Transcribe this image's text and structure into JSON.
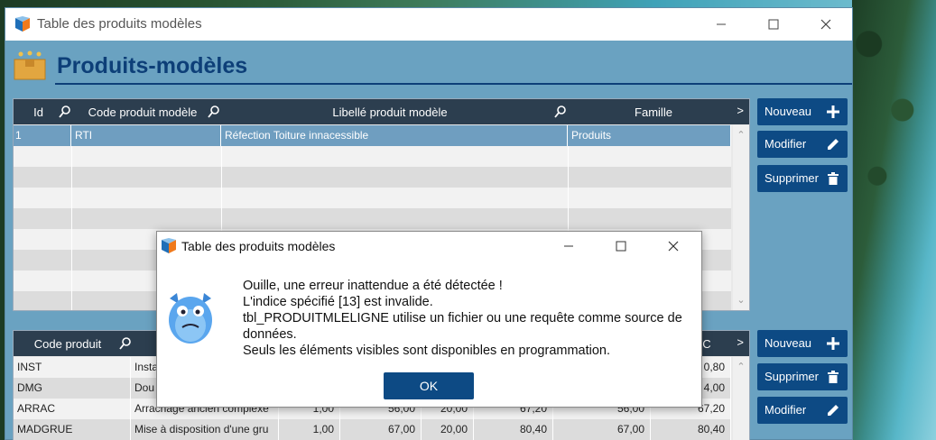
{
  "window": {
    "title": "Table des produits modèles",
    "page_title": "Produits-modèles"
  },
  "top_grid": {
    "columns": [
      "Id",
      "Code produit modèle",
      "Libellé produit modèle",
      "Famille"
    ],
    "more_icon": ">",
    "rows": [
      {
        "id": "1",
        "code": "RTI",
        "libelle": "Réfection Toiture innacessible",
        "famille": "Produits"
      }
    ]
  },
  "top_buttons": {
    "new": "Nouveau",
    "edit": "Modifier",
    "delete": "Supprimer"
  },
  "bottom_grid": {
    "columns": [
      "Code produit"
    ],
    "right_header_fragment": "C",
    "more_icon": ">",
    "rows": [
      {
        "code": "INST",
        "libelle": "Insta",
        "c1": "",
        "c2": "",
        "c3": "",
        "c4": "",
        "c5": "",
        "c6": "0,80"
      },
      {
        "code": "DMG",
        "libelle": "Dou",
        "c1": "",
        "c2": "",
        "c3": "",
        "c4": "",
        "c5": "",
        "c6": "4,00"
      },
      {
        "code": "ARRAC",
        "libelle": "Arrachage ancien complexe",
        "c1": "1,00",
        "c2": "56,00",
        "c3": "20,00",
        "c4": "67,20",
        "c5": "56,00",
        "c6": "67,20"
      },
      {
        "code": "MADGRUE",
        "libelle": "Mise à disposition d'une gru",
        "c1": "1,00",
        "c2": "67,00",
        "c3": "20,00",
        "c4": "80,40",
        "c5": "67,00",
        "c6": "80,40"
      }
    ]
  },
  "bottom_buttons": {
    "new": "Nouveau",
    "delete": "Supprimer",
    "edit": "Modifier"
  },
  "dialog": {
    "title": "Table des produits modèles",
    "lines": [
      "Ouille, une erreur inattendue a été détectée !",
      "L'indice spécifié [13] est invalide.",
      "tbl_PRODUITMLELIGNE utilise un fichier ou une requête comme source de données.",
      "Seuls les éléments visibles sont disponibles en programmation."
    ],
    "ok": "OK"
  },
  "colors": {
    "window_bg": "#6aa2c1",
    "title_blue": "#0d3f78",
    "button_blue": "#0d4a84",
    "grid_header": "#2c3e4f",
    "selected_row": "#6f9ec0"
  }
}
